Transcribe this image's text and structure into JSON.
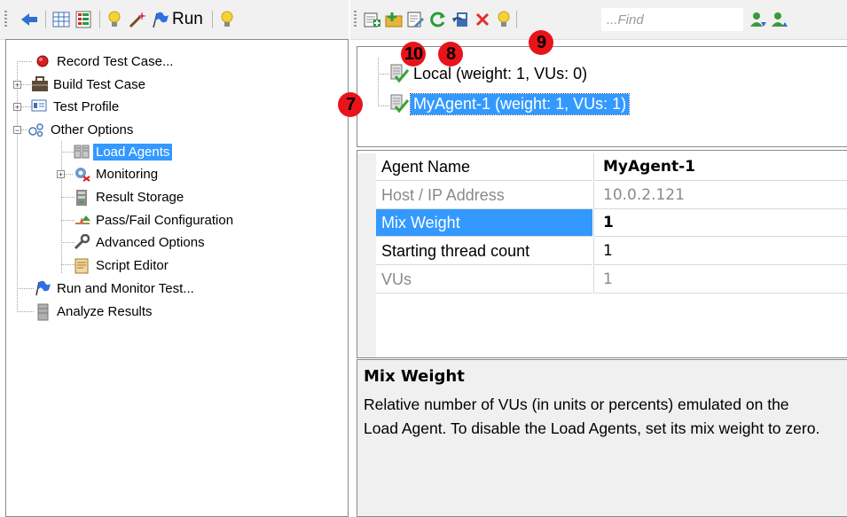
{
  "left_toolbar": {
    "run_label": "Run",
    "icons": [
      "back-arrow-icon",
      "grid-view-icon",
      "list-view-icon",
      "lightbulb-icon",
      "magic-wand-icon",
      "run-flag-icon",
      "lightbulb-icon"
    ]
  },
  "right_toolbar": {
    "icons": [
      "add-agent-icon",
      "add-agent-folder-icon",
      "edit-agent-icon",
      "refresh-icon",
      "undo-icon",
      "delete-icon",
      "lightbulb-icon"
    ],
    "find_placeholder": "...Find",
    "find_next_icon": "find-next-icon",
    "find_prev_icon": "find-prev-icon"
  },
  "tree": {
    "items": [
      {
        "label": "Record Test Case...",
        "icon": "record-icon"
      },
      {
        "label": "Build Test Case",
        "icon": "toolbox-icon",
        "expander": "+"
      },
      {
        "label": "Test Profile",
        "icon": "profile-icon",
        "expander": "+"
      },
      {
        "label": "Other Options",
        "icon": "options-icon",
        "expander": "−"
      },
      {
        "label": "Load Agents",
        "icon": "load-agents-icon",
        "selected": true
      },
      {
        "label": "Monitoring",
        "icon": "monitoring-icon",
        "expander": "+"
      },
      {
        "label": "Result Storage",
        "icon": "storage-icon"
      },
      {
        "label": "Pass/Fail Configuration",
        "icon": "pass-fail-icon"
      },
      {
        "label": "Advanced Options",
        "icon": "wrench-icon"
      },
      {
        "label": "Script Editor",
        "icon": "script-icon"
      },
      {
        "label": "Run and Monitor Test...",
        "icon": "run-flag-icon"
      },
      {
        "label": "Analyze Results",
        "icon": "database-icon"
      }
    ]
  },
  "agents": [
    {
      "label": "Local (weight: 1, VUs: 0)",
      "selected": false
    },
    {
      "label": "MyAgent-1 (weight: 1, VUs: 1)",
      "selected": true
    }
  ],
  "properties": [
    {
      "name": "Agent Name",
      "value": "MyAgent-1",
      "value_bold": true
    },
    {
      "name": "Host / IP Address",
      "value": "10.0.2.121",
      "readonly": true
    },
    {
      "name": "Mix Weight",
      "value": "1",
      "selected": true,
      "value_bold": true
    },
    {
      "name": "Starting thread count",
      "value": "1"
    },
    {
      "name": "VUs",
      "value": "1",
      "readonly": true
    }
  ],
  "description": {
    "title": "Mix Weight",
    "text": "Relative number of VUs (in units or percents) emulated on the Load Agent. To disable the Load Agents, set its mix weight to zero."
  },
  "callouts": [
    "10",
    "8",
    "9",
    "7"
  ],
  "colors": {
    "selection": "#3399ff",
    "callout": "#e8141a"
  }
}
